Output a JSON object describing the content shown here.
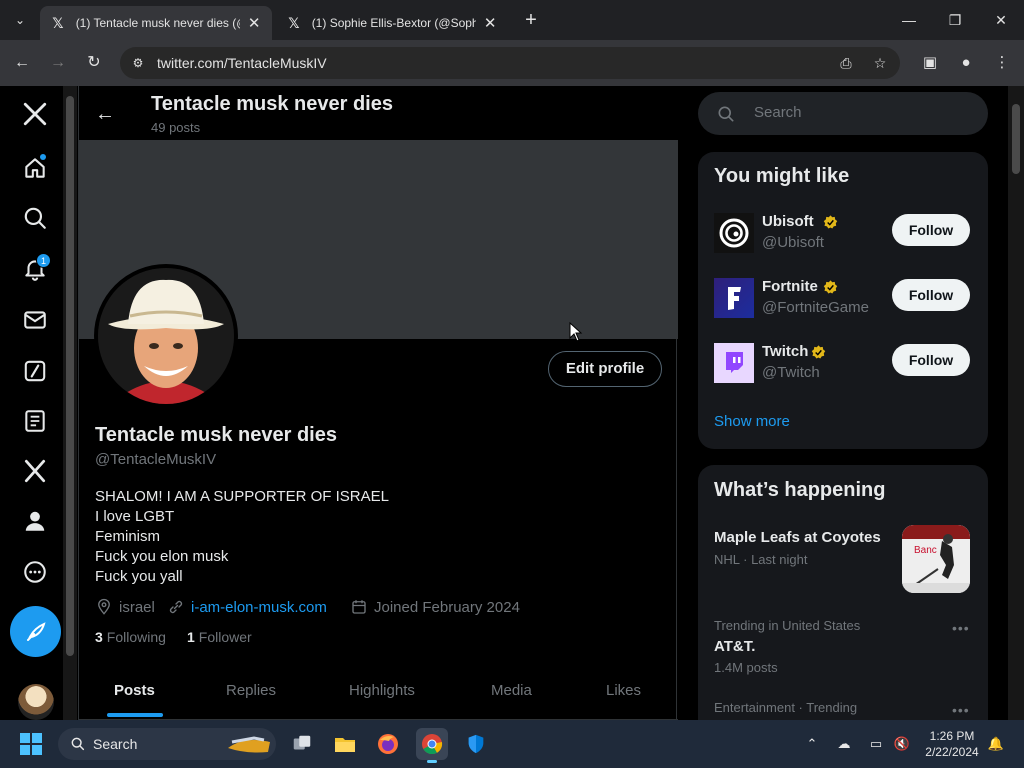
{
  "browser": {
    "tabs": [
      {
        "title": "(1) Tentacle musk never dies (@",
        "active": true
      },
      {
        "title": "(1) Sophie Ellis-Bextor (@Sophi",
        "active": false
      }
    ],
    "url": "twitter.com/TentacleMuskIV"
  },
  "nav": {
    "notifications_count": "1"
  },
  "profile": {
    "header_name": "Tentacle musk never dies",
    "post_count": "49 posts",
    "name": "Tentacle musk never dies",
    "handle": "@TentacleMuskIV",
    "edit_label": "Edit profile",
    "bio": [
      "SHALOM! I AM A SUPPORTER OF ISRAEL",
      "I love LGBT",
      "Feminism",
      "Fuck you elon musk",
      "Fuck you yall"
    ],
    "location": "israel",
    "website": "i-am-elon-musk.com",
    "joined": "Joined February 2024",
    "following_count": "3",
    "following_label": "Following",
    "followers_count": "1",
    "followers_label": "Follower",
    "tabs": [
      "Posts",
      "Replies",
      "Highlights",
      "Media",
      "Likes"
    ],
    "active_tab": "Posts"
  },
  "search": {
    "placeholder": "Search"
  },
  "suggestions": {
    "title": "You might like",
    "items": [
      {
        "name": "Ubisoft",
        "handle": "@Ubisoft",
        "follow": "Follow"
      },
      {
        "name": "Fortnite",
        "handle": "@FortniteGame",
        "follow": "Follow"
      },
      {
        "name": "Twitch",
        "handle": "@Twitch",
        "follow": "Follow"
      }
    ],
    "show_more": "Show more"
  },
  "happening": {
    "title": "What’s happening",
    "items": [
      {
        "title": "Maple Leafs at Coyotes",
        "sub": "NHL · Last night"
      },
      {
        "context": "Trending in United States",
        "title": "AT&T.",
        "sub": "1.4M posts"
      },
      {
        "context": "Entertainment · Trending"
      }
    ]
  },
  "taskbar": {
    "search_label": "Search",
    "time": "1:26 PM",
    "date": "2/22/2024"
  },
  "colors": {
    "accent": "#1d9bf0",
    "verified": "#e2b719"
  }
}
